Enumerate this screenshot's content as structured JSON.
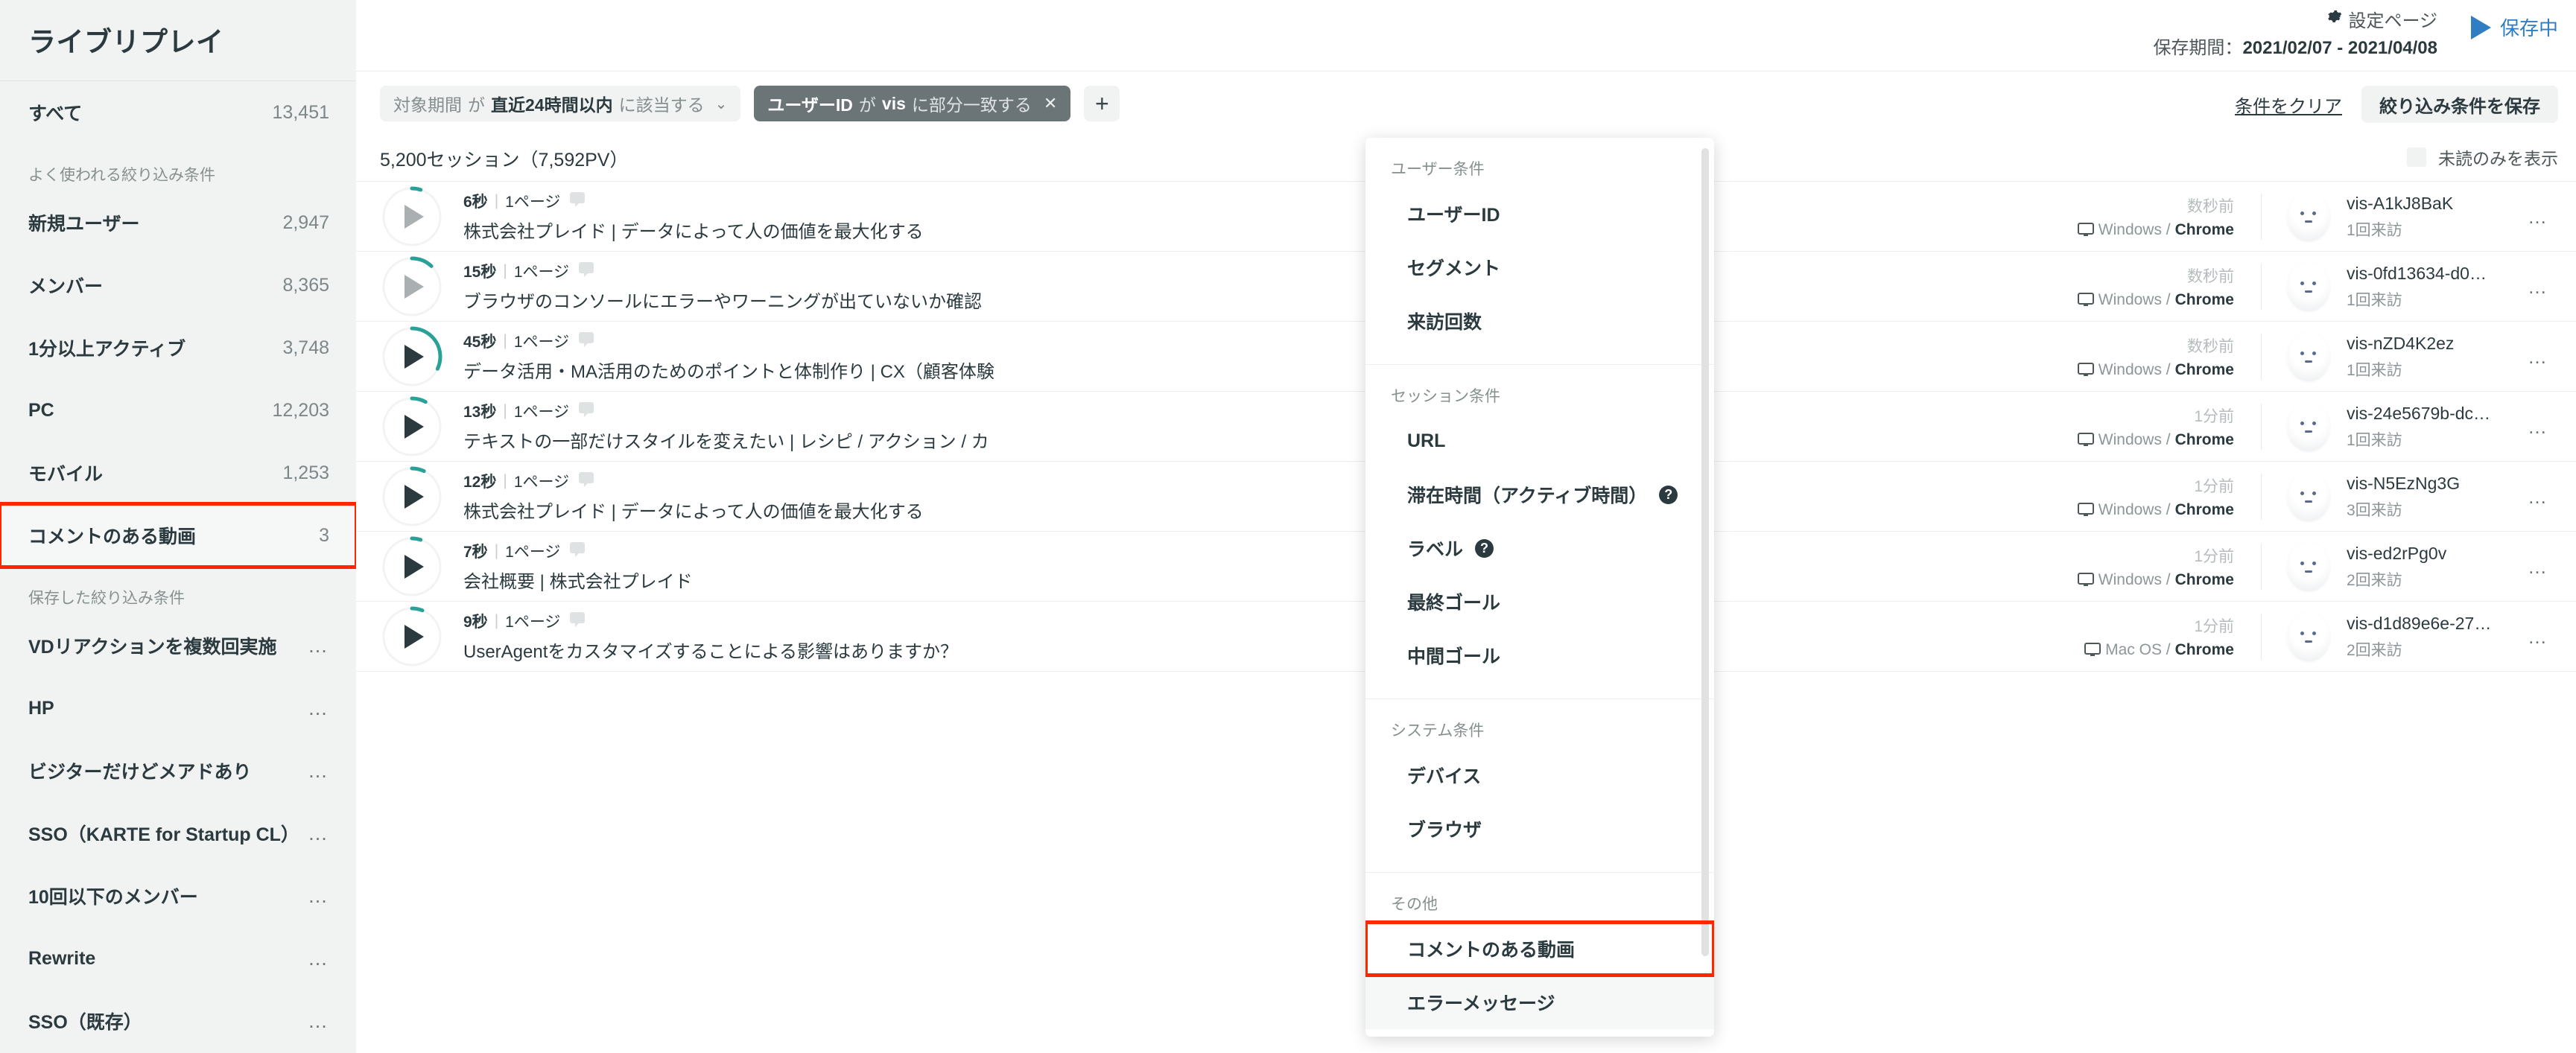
{
  "sidebar": {
    "title": "ライブリプレイ",
    "all": {
      "label": "すべて",
      "count": "13,451"
    },
    "common_section": "よく使われる絞り込み条件",
    "common_items": [
      {
        "label": "新規ユーザー",
        "count": "2,947"
      },
      {
        "label": "メンバー",
        "count": "8,365"
      },
      {
        "label": "1分以上アクティブ",
        "count": "3,748"
      },
      {
        "label": "PC",
        "count": "12,203"
      },
      {
        "label": "モバイル",
        "count": "1,253"
      },
      {
        "label": "コメントのある動画",
        "count": "3"
      }
    ],
    "saved_section": "保存した絞り込み条件",
    "saved_items": [
      {
        "label": "VDリアクションを複数回実施",
        "menu": "…"
      },
      {
        "label": "HP",
        "menu": "…"
      },
      {
        "label": "ビジターだけどメアドあり",
        "menu": "…"
      },
      {
        "label": "SSO（KARTE for Startup CL）",
        "menu": "…"
      },
      {
        "label": "10回以下のメンバー",
        "menu": "…"
      },
      {
        "label": "Rewrite",
        "menu": "…"
      },
      {
        "label": "SSO（既存）",
        "menu": "…"
      }
    ]
  },
  "header": {
    "settings_label": "設定ページ",
    "settings_icon": "gear-icon",
    "period_prefix": "保存期間：",
    "period_value": "2021/02/07 - 2021/04/08",
    "live_label": "保存中",
    "live_icon": "play-icon",
    "accent_blue": "#2f7ec4"
  },
  "filterbar": {
    "chips": [
      {
        "field": "対象期間",
        "op1": "が",
        "value": "直近24時間以内",
        "op2": "に該当する",
        "chev": "⌄",
        "style": "light"
      },
      {
        "field": "ユーザーID",
        "op1": "が",
        "value": "vis",
        "op2": "に部分一致する",
        "close": "✕",
        "style": "dark"
      }
    ],
    "add_label": "+",
    "clear_label": "条件をクリア",
    "save_label": "絞り込み条件を保存"
  },
  "sessions": {
    "count_text": "5,200セッション（7,592PV）",
    "unread_label": "未読のみを表示",
    "rows": [
      {
        "duration": "6秒",
        "pages": "1ページ",
        "title": "株式会社プレイド | データによって人の価値を最大化する",
        "ago": "数秒前",
        "os": "Windows",
        "browser": "Chrome",
        "vis_id": "vis-A1kJ8BaK",
        "visits": "1回来訪",
        "progress": 5,
        "active": false
      },
      {
        "duration": "15秒",
        "pages": "1ページ",
        "title": "ブラウザのコンソールにエラーやワーニングが出ていないか確認",
        "ago": "数秒前",
        "os": "Windows",
        "browser": "Chrome",
        "vis_id": "vis-0fd13634-d0…",
        "visits": "1回来訪",
        "progress": 12,
        "active": false
      },
      {
        "duration": "45秒",
        "pages": "1ページ",
        "title": "データ活用・MA活用のためのポイントと体制作り | CX（顧客体験",
        "ago": "数秒前",
        "os": "Windows",
        "browser": "Chrome",
        "vis_id": "vis-nZD4K2ez",
        "visits": "1回来訪",
        "progress": 32,
        "active": true
      },
      {
        "duration": "13秒",
        "pages": "1ページ",
        "title": "テキストの一部だけスタイルを変えたい | レシピ / アクション / カ",
        "ago": "1分前",
        "os": "Windows",
        "browser": "Chrome",
        "vis_id": "vis-24e5679b-dc…",
        "visits": "1回来訪",
        "progress": 8,
        "active": true
      },
      {
        "duration": "12秒",
        "pages": "1ページ",
        "title": "株式会社プレイド | データによって人の価値を最大化する",
        "ago": "1分前",
        "os": "Windows",
        "browser": "Chrome",
        "vis_id": "vis-N5EzNg3G",
        "visits": "3回来訪",
        "progress": 7,
        "active": true
      },
      {
        "duration": "7秒",
        "pages": "1ページ",
        "title": "会社概要 | 株式会社プレイド",
        "ago": "1分前",
        "os": "Windows",
        "browser": "Chrome",
        "vis_id": "vis-ed2rPg0v",
        "visits": "2回来訪",
        "progress": 5,
        "active": true
      },
      {
        "duration": "9秒",
        "pages": "1ページ",
        "title": "UserAgentをカスタマイズすることによる影響はありますか？",
        "ago": "1分前",
        "os": "Mac OS",
        "browser": "Chrome",
        "vis_id": "vis-d1d89e6e-27…",
        "visits": "2回来訪",
        "progress": 6,
        "active": true
      }
    ]
  },
  "dropdown": {
    "groups": [
      {
        "section": "ユーザー条件",
        "items": [
          {
            "label": "ユーザーID"
          },
          {
            "label": "セグメント"
          },
          {
            "label": "来訪回数"
          }
        ]
      },
      {
        "section": "セッション条件",
        "items": [
          {
            "label": "URL"
          },
          {
            "label": "滞在時間（アクティブ時間）",
            "help": "?"
          },
          {
            "label": "ラベル",
            "help": "?"
          },
          {
            "label": "最終ゴール"
          },
          {
            "label": "中間ゴール"
          }
        ]
      },
      {
        "section": "システム条件",
        "items": [
          {
            "label": "デバイス"
          },
          {
            "label": "ブラウザ"
          }
        ]
      },
      {
        "section": "その他",
        "items": [
          {
            "label": "コメントのある動画",
            "highlight": true
          },
          {
            "label": "エラーメッセージ",
            "grey": true
          }
        ]
      }
    ]
  },
  "colors": {
    "highlight_red": "#ff2600",
    "teal": "#2aa198",
    "sidebar_bg": "#f1f2f2"
  }
}
